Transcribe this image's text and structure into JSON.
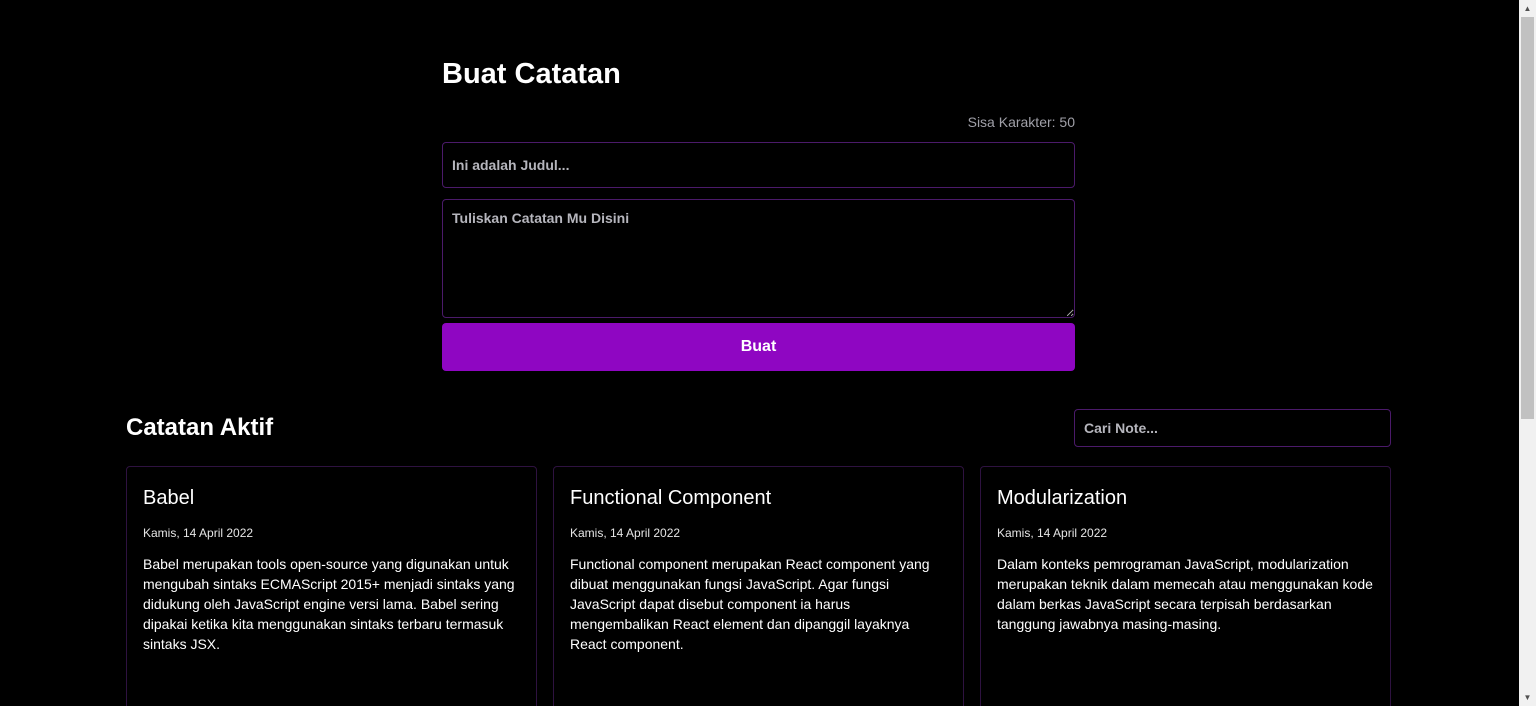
{
  "form": {
    "heading": "Buat Catatan",
    "counter_text": "Sisa Karakter: 50",
    "title_placeholder": "Ini adalah Judul...",
    "body_placeholder": "Tuliskan Catatan Mu Disini",
    "submit_label": "Buat"
  },
  "notes_section": {
    "heading": "Catatan Aktif",
    "search_placeholder": "Cari Note..."
  },
  "notes": [
    {
      "title": "Babel",
      "date": "Kamis, 14 April 2022",
      "body": "Babel merupakan tools open-source yang digunakan untuk mengubah sintaks ECMAScript 2015+ menjadi sintaks yang didukung oleh JavaScript engine versi lama. Babel sering dipakai ketika kita menggunakan sintaks terbaru termasuk sintaks JSX."
    },
    {
      "title": "Functional Component",
      "date": "Kamis, 14 April 2022",
      "body": "Functional component merupakan React component yang dibuat menggunakan fungsi JavaScript. Agar fungsi JavaScript dapat disebut component ia harus mengembalikan React element dan dipanggil layaknya React component."
    },
    {
      "title": "Modularization",
      "date": "Kamis, 14 April 2022",
      "body": "Dalam konteks pemrograman JavaScript, modularization merupakan teknik dalam memecah atau menggunakan kode dalam berkas JavaScript secara terpisah berdasarkan tanggung jawabnya masing-masing."
    }
  ],
  "colors": {
    "accent": "#8f06c2",
    "border": "#4b1a6a",
    "background": "#000000"
  },
  "icons": {
    "scroll_up": "scroll-up-arrow-icon",
    "scroll_down": "scroll-down-arrow-icon"
  }
}
